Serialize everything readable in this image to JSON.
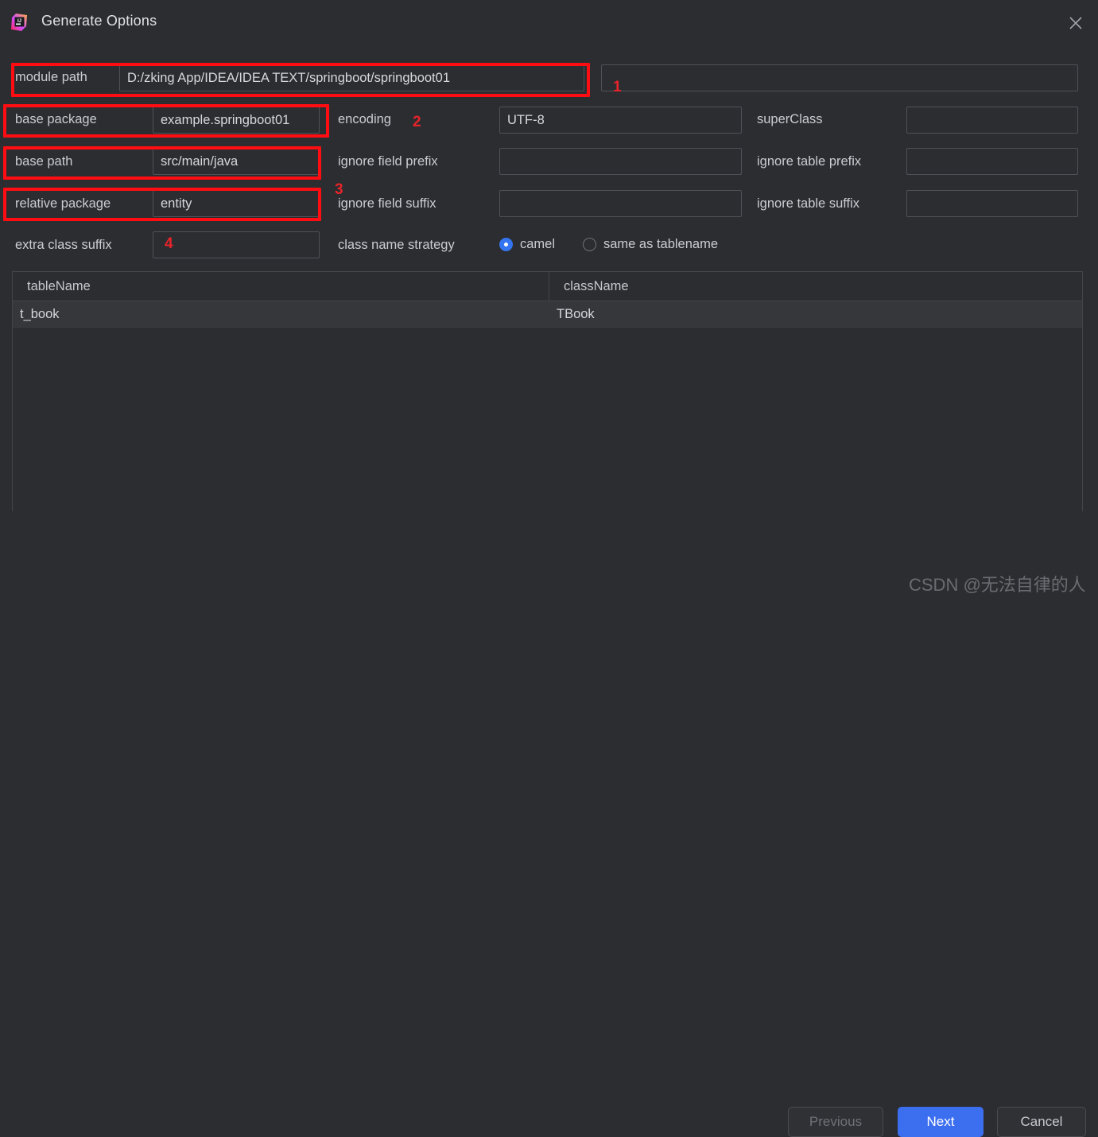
{
  "window": {
    "title": "Generate Options",
    "icon": "intellij-idea-icon",
    "close_icon": "close-icon"
  },
  "form": {
    "module_path": {
      "label": "module path",
      "value": "D:/zking App/IDEA/IDEA TEXT/springboot/springboot01"
    },
    "second_module_field": {
      "value": ""
    },
    "base_package": {
      "label": "base package",
      "value": "example.springboot01"
    },
    "encoding": {
      "label": "encoding",
      "value": "UTF-8"
    },
    "super_class": {
      "label": "superClass",
      "value": ""
    },
    "base_path": {
      "label": "base path",
      "value": "src/main/java"
    },
    "ignore_field_prefix": {
      "label": "ignore field prefix",
      "value": ""
    },
    "ignore_table_prefix": {
      "label": "ignore table prefix",
      "value": ""
    },
    "relative_package": {
      "label": "relative package",
      "value": "entity"
    },
    "ignore_field_suffix": {
      "label": "ignore field suffix",
      "value": ""
    },
    "ignore_table_suffix": {
      "label": "ignore table suffix",
      "value": ""
    },
    "extra_class_suffix": {
      "label": "extra class suffix",
      "value": ""
    },
    "class_name_strategy": {
      "label": "class name strategy",
      "selected": "camel",
      "options": [
        {
          "id": "camel",
          "label": "camel",
          "selected": true
        },
        {
          "id": "same-as-tablename",
          "label": "same as tablename",
          "selected": false
        }
      ]
    }
  },
  "table": {
    "columns": [
      "tableName",
      "className"
    ],
    "rows": [
      {
        "tableName": "t_book",
        "className": "TBook"
      }
    ]
  },
  "footer": {
    "previous_label": "Previous",
    "next_label": "Next",
    "cancel_label": "Cancel"
  },
  "annotations": {
    "n1": "1",
    "n2": "2",
    "n3": "3",
    "n4": "4",
    "color": "#FF0D12"
  },
  "watermark": "CSDN @无法自律的人"
}
